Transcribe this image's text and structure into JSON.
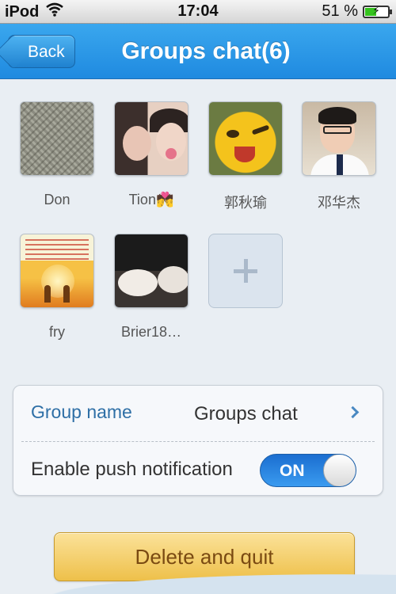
{
  "status_bar": {
    "carrier": "iPod",
    "time": "17:04",
    "battery_text": "51 %",
    "battery_level": 0.51
  },
  "nav": {
    "back_label": "Back",
    "title": "Groups chat(6)"
  },
  "members": [
    {
      "name": "Don"
    },
    {
      "name": "Tion💏"
    },
    {
      "name": "郭秋瑜"
    },
    {
      "name": "邓华杰"
    },
    {
      "name": "fry"
    },
    {
      "name": "Brier18…"
    }
  ],
  "settings": {
    "group_name_label": "Group name",
    "group_name_value": "Groups chat",
    "push_label": "Enable push notification",
    "push_toggle_text": "ON"
  },
  "actions": {
    "delete_label": "Delete and quit"
  },
  "colors": {
    "nav_blue": "#2996e8",
    "label_blue": "#2e6fa6",
    "toggle_blue": "#2a86e4",
    "delete_yellow": "#f3cd65",
    "delete_text": "#7a4a12"
  }
}
